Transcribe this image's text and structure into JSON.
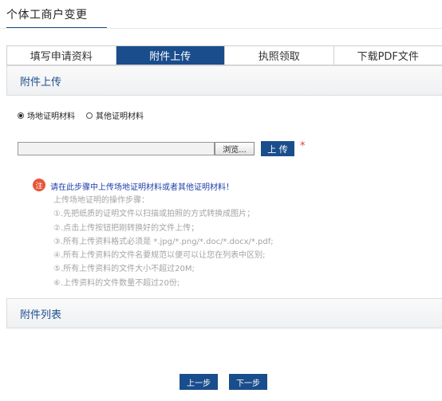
{
  "page": {
    "title": "个体工商户变更"
  },
  "tabs": [
    {
      "label": "填写申请资料",
      "active": false
    },
    {
      "label": "附件上传",
      "active": true
    },
    {
      "label": "执照领取",
      "active": false
    },
    {
      "label": "下载PDF文件",
      "active": false
    }
  ],
  "upload_section": {
    "title": "附件上传",
    "radios": [
      {
        "label": "场地证明材料",
        "checked": true
      },
      {
        "label": "其他证明材料",
        "checked": false
      }
    ],
    "file_input_value": "",
    "browse_label": "浏览...",
    "upload_label": "上 传",
    "required_mark": "*",
    "notice_icon": "注",
    "notice_text": "请在此步骤中上传场地证明材料或者其他证明材料！",
    "steps": [
      "上传场地证明的操作步骤：",
      "①.先把纸质的证明文件以扫描或拍照的方式转换成图片；",
      "②.点击上传按钮把刚转换好的文件上传；",
      "③.所有上传资料格式必须是 *.jpg/*.png/*.doc/*.docx/*.pdf;",
      "④.所有上传资料的文件名要规范以便可以让您在列表中区别;",
      "⑤.所有上传资料的文件大小不超过20M;",
      "⑥.上传资料的文件数量不超过20份;"
    ]
  },
  "list_section": {
    "title": "附件列表"
  },
  "nav": {
    "prev_label": "上一步",
    "next_label": "下一步"
  },
  "colors": {
    "primary": "#1a4d8c",
    "notice": "#e8553a",
    "required": "#e23a3a"
  }
}
